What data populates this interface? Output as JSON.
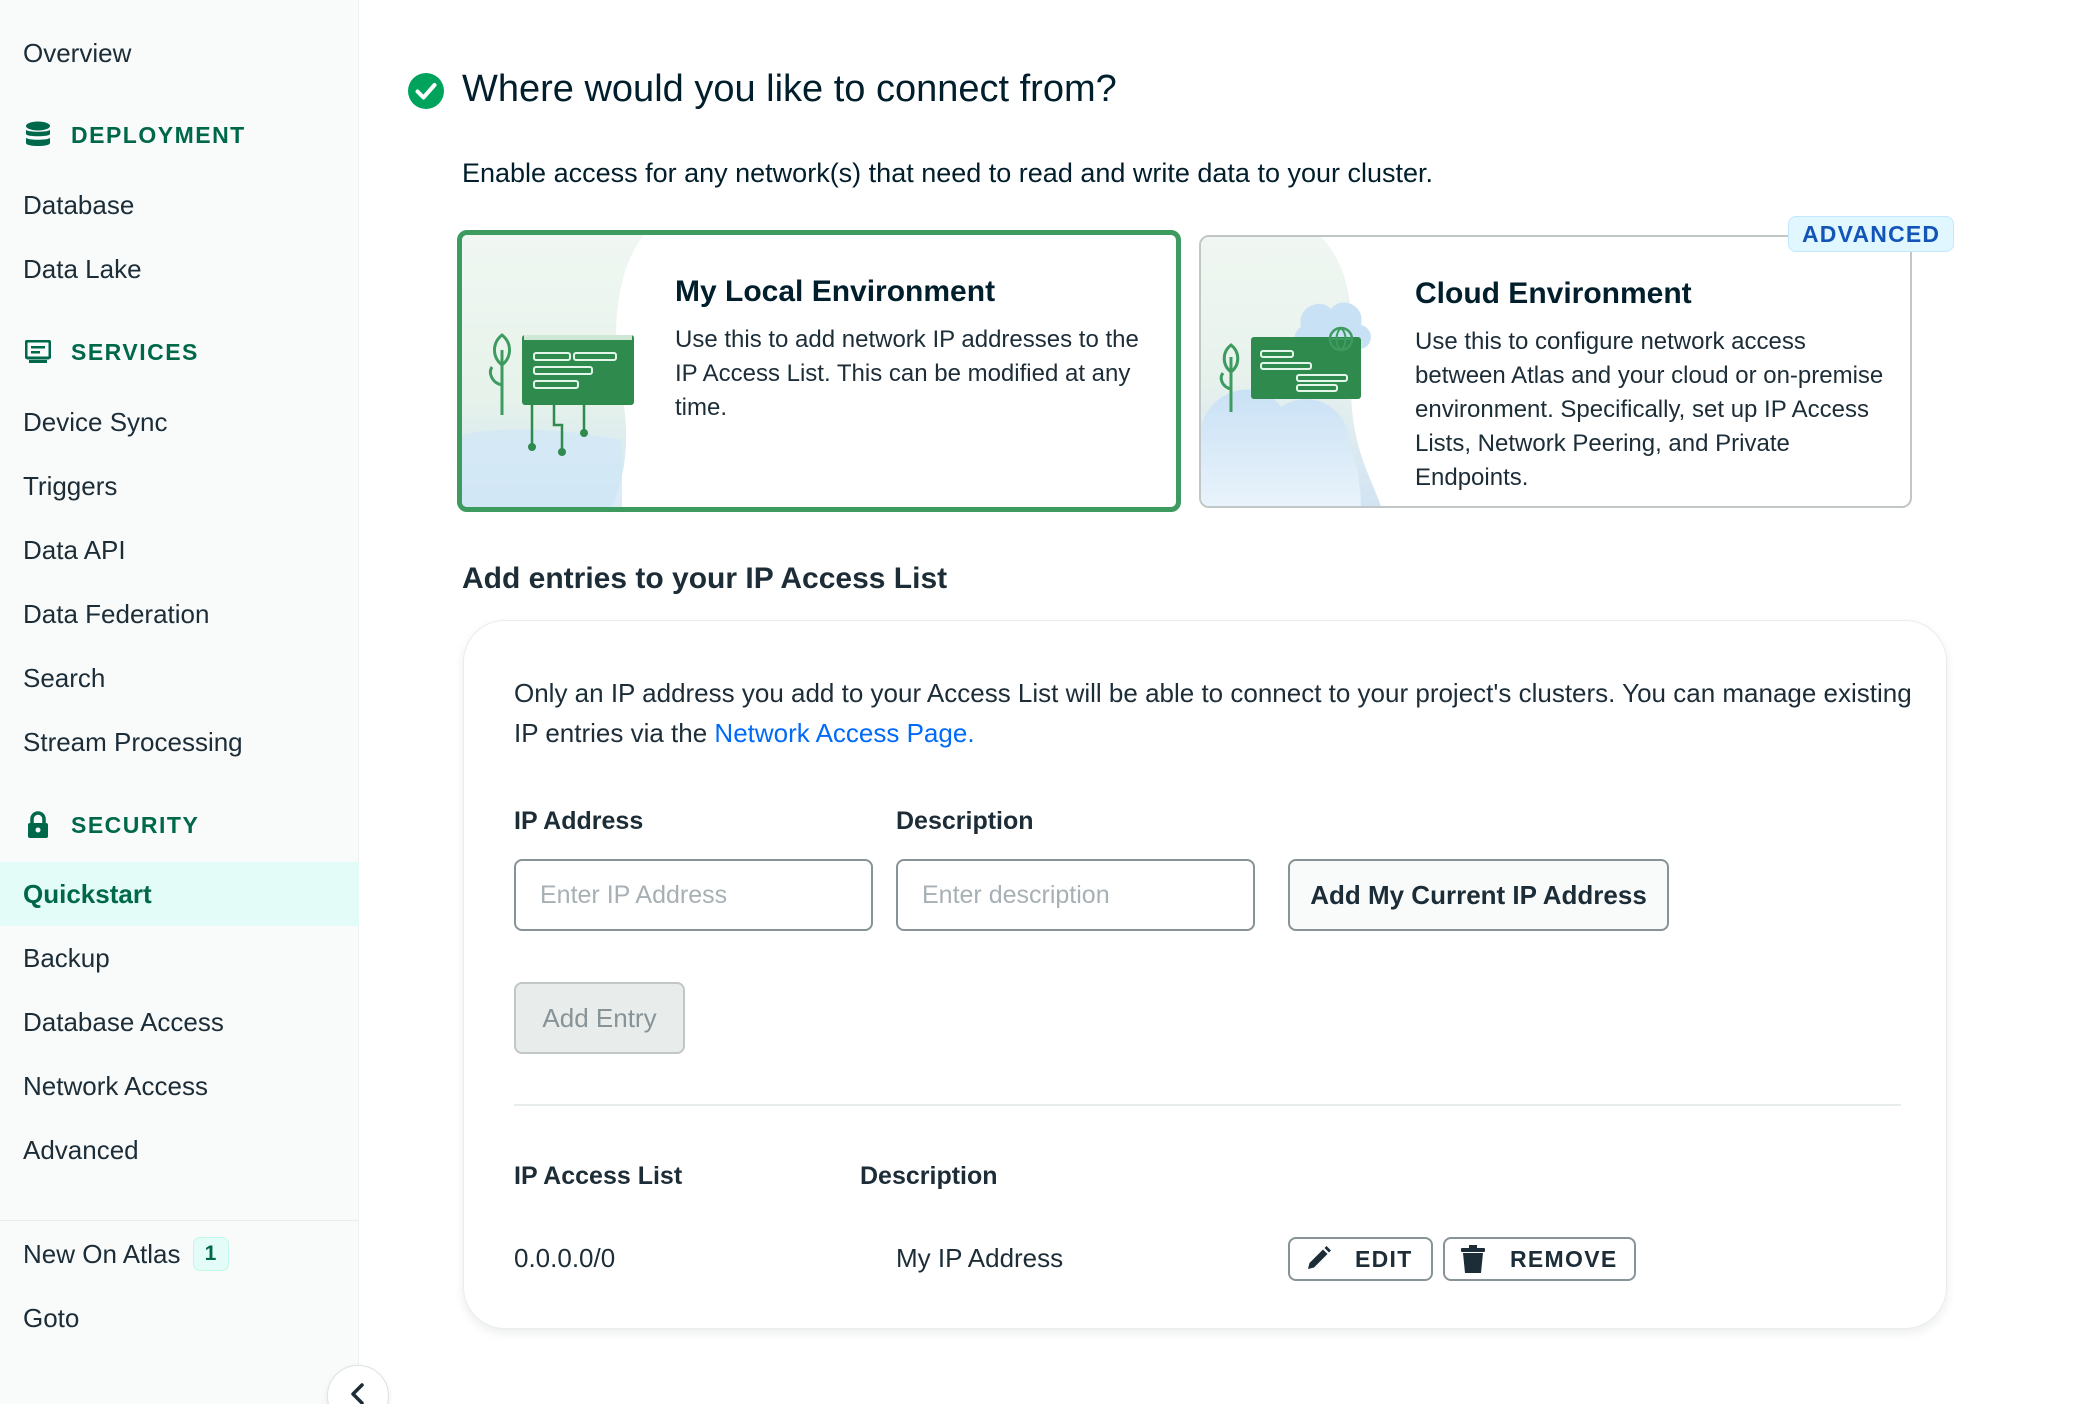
{
  "sidebar": {
    "overview": "Overview",
    "sections": {
      "deployment": {
        "title": "DEPLOYMENT",
        "icon": "database-icon",
        "items": [
          "Database",
          "Data Lake"
        ]
      },
      "services": {
        "title": "SERVICES",
        "icon": "monitor-icon",
        "items": [
          "Device Sync",
          "Triggers",
          "Data API",
          "Data Federation",
          "Search",
          "Stream Processing"
        ]
      },
      "security": {
        "title": "SECURITY",
        "icon": "lock-icon",
        "items": [
          "Quickstart",
          "Backup",
          "Database Access",
          "Network Access",
          "Advanced"
        ],
        "active": "Quickstart"
      }
    },
    "bottom": {
      "new_on_atlas": "New On Atlas",
      "new_on_atlas_count": "1",
      "goto": "Goto"
    },
    "collapse_icon": "chevron-left-icon"
  },
  "main": {
    "title": "Where would you like to connect from?",
    "subtitle": "Enable access for any network(s) that need to read and write data to your cluster.",
    "cards": {
      "local": {
        "title": "My Local Environment",
        "description": "Use this to add network IP addresses to the IP Access List. This can be modified at any time.",
        "selected": true
      },
      "cloud": {
        "title": "Cloud Environment",
        "description": "Use this to configure network access between Atlas and your cloud or on-premise environment. Specifically, set up IP Access Lists, Network Peering, and Private Endpoints.",
        "tag": "ADVANCED"
      }
    },
    "section_heading": "Add entries to your IP Access List",
    "panel": {
      "info_text": "Only an IP address you add to your Access List will be able to connect to your project's clusters. You can manage existing IP entries via the ",
      "info_link": "Network Access Page.",
      "ip_label": "IP Address",
      "ip_placeholder": "Enter IP Address",
      "desc_label": "Description",
      "desc_placeholder": "Enter description",
      "add_current_ip": "Add My Current IP Address",
      "add_entry": "Add Entry",
      "list_header_ip": "IP Access List",
      "list_header_desc": "Description",
      "entries": [
        {
          "ip": "0.0.0.0/0",
          "description": "My IP Address"
        }
      ],
      "edit_label": "EDIT",
      "remove_label": "REMOVE"
    }
  },
  "colors": {
    "brand_green": "#00684a",
    "selected_border": "#3d9b5f",
    "link_blue": "#016bf8",
    "active_bg": "#e3fcf7"
  }
}
